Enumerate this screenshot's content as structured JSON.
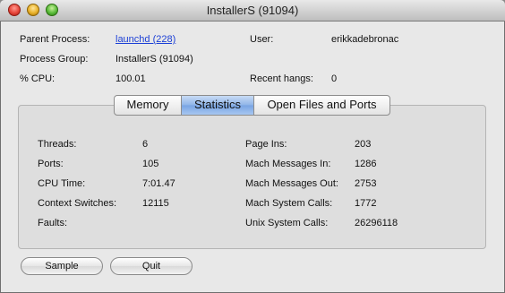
{
  "window": {
    "title": "InstallerS (91094)"
  },
  "info": {
    "parent_process_label": "Parent Process:",
    "parent_process_value": "launchd (228)",
    "user_label": "User:",
    "user_value": "erikkadebronac",
    "process_group_label": "Process Group:",
    "process_group_value": "InstallerS (91094)",
    "cpu_label": "% CPU:",
    "cpu_value": "100.01",
    "recent_hangs_label": "Recent hangs:",
    "recent_hangs_value": "0"
  },
  "tabs": [
    {
      "label": "Memory",
      "active": false
    },
    {
      "label": "Statistics",
      "active": true
    },
    {
      "label": "Open Files and Ports",
      "active": false
    }
  ],
  "stats": {
    "left": [
      {
        "label": "Threads:",
        "value": "6"
      },
      {
        "label": "Ports:",
        "value": "105"
      },
      {
        "label": "CPU Time:",
        "value": "7:01.47"
      },
      {
        "label": "Context Switches:",
        "value": "12115"
      },
      {
        "label": "Faults:",
        "value": ""
      }
    ],
    "right": [
      {
        "label": "Page Ins:",
        "value": "203"
      },
      {
        "label": "Mach Messages In:",
        "value": "1286"
      },
      {
        "label": "Mach Messages Out:",
        "value": "2753"
      },
      {
        "label": "Mach System Calls:",
        "value": "1772"
      },
      {
        "label": "Unix System Calls:",
        "value": "26296118"
      }
    ]
  },
  "buttons": {
    "sample": "Sample",
    "quit": "Quit"
  }
}
